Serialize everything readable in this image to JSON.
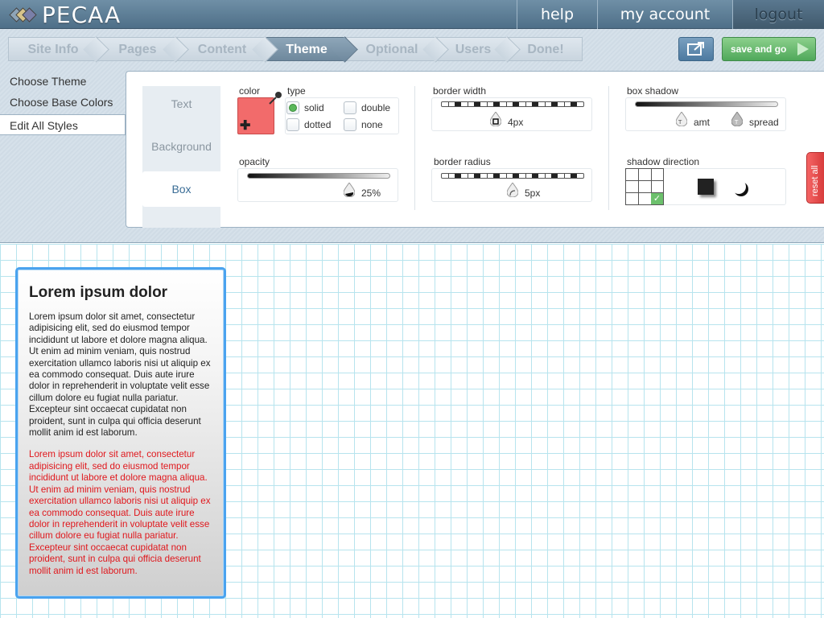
{
  "app": {
    "title": "PECAA"
  },
  "topnav": {
    "help": "help",
    "account": "my account",
    "logout": "logout"
  },
  "steps": [
    {
      "label": "Site Info"
    },
    {
      "label": "Pages"
    },
    {
      "label": "Content"
    },
    {
      "label": "Theme",
      "active": true
    },
    {
      "label": "Optional"
    },
    {
      "label": "Users"
    },
    {
      "label": "Done!"
    }
  ],
  "actions": {
    "save_label": "save and go"
  },
  "sidemenu": {
    "choose_theme": "Choose Theme",
    "choose_base_colors": "Choose Base Colors",
    "edit_all_styles": "Edit All Styles"
  },
  "tabs": {
    "text": "Text",
    "background": "Background",
    "box": "Box"
  },
  "color": {
    "label": "color",
    "value": "#f26b6b"
  },
  "type": {
    "label": "type",
    "solid": "solid",
    "double": "double",
    "dotted": "dotted",
    "none": "none",
    "selected": "solid"
  },
  "border_width": {
    "label": "border width",
    "value": "4px"
  },
  "box_shadow": {
    "label": "box shadow",
    "amt": "amt",
    "spread": "spread"
  },
  "opacity": {
    "label": "opacity",
    "value": "25%"
  },
  "border_radius": {
    "label": "border radius",
    "value": "5px"
  },
  "shadow_direction": {
    "label": "shadow direction"
  },
  "reset": {
    "label": "reset all"
  },
  "preview": {
    "title": "Lorem ipsum dolor",
    "body1": "Lorem ipsum dolor sit amet, consectetur adipisicing elit, sed do eiusmod tempor incididunt ut labore et dolore magna aliqua. Ut enim ad minim veniam, quis nostrud exercitation ullamco laboris nisi ut aliquip ex ea commodo consequat. Duis aute irure dolor in reprehenderit in voluptate velit esse cillum dolore eu fugiat nulla pariatur. Excepteur sint occaecat cupidatat non proident, sunt in culpa qui officia deserunt mollit anim id est laborum.",
    "body2": "Lorem ipsum dolor sit amet, consectetur adipisicing elit, sed do eiusmod tempor incididunt ut labore et dolore magna aliqua. Ut enim ad minim veniam, quis nostrud exercitation ullamco laboris nisi ut aliquip ex ea commodo consequat. Duis aute irure dolor in reprehenderit in voluptate velit esse cillum dolore eu fugiat nulla pariatur. Excepteur sint occaecat cupidatat non proident, sunt in culpa qui officia deserunt mollit anim id est laborum."
  },
  "colors": {
    "accent": "#4aa3ef",
    "save": "#4fa85a",
    "reset": "#d83c3c",
    "red_text": "#e0171c"
  }
}
